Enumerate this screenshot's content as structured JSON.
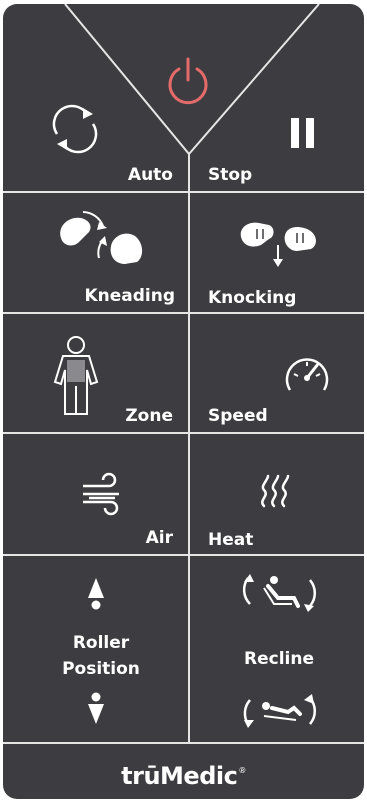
{
  "remote": {
    "auto_label": "Auto",
    "stop_label": "Stop",
    "kneading_label": "Kneading",
    "knocking_label": "Knocking",
    "zone_label": "Zone",
    "speed_label": "Speed",
    "air_label": "Air",
    "heat_label": "Heat",
    "roller_label_line1": "Roller",
    "roller_label_line2": "Position",
    "recline_label": "Recline"
  },
  "brand": {
    "name": "trūMedic",
    "trademark": "®"
  },
  "colors": {
    "panel": "#3d3d41",
    "divider": "#e6e6e6",
    "power_accent": "#e56a6a",
    "text": "#ffffff"
  },
  "icons": [
    "power-icon",
    "auto-cycle-icon",
    "pause-icon",
    "kneading-icon",
    "knocking-icon",
    "body-zone-icon",
    "speedometer-icon",
    "air-icon",
    "heat-icon",
    "arrow-up-icon",
    "arrow-down-icon",
    "recline-back-icon",
    "recline-legs-icon"
  ]
}
